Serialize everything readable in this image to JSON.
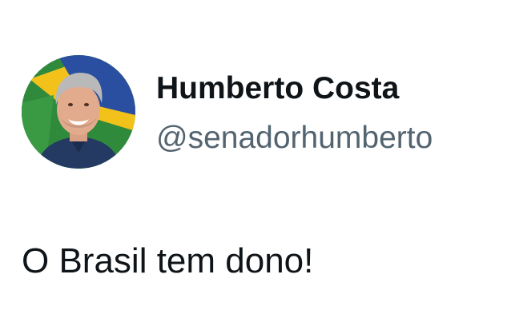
{
  "author": {
    "display_name": "Humberto Costa",
    "handle": "@senadorhumberto",
    "avatar_icon": "profile-photo-avatar"
  },
  "tweet": {
    "text": "O Brasil tem dono!"
  },
  "colors": {
    "text_primary": "#0f1419",
    "text_secondary": "#536471",
    "background": "#ffffff",
    "avatar_green": "#2f8a3c",
    "avatar_yellow": "#f2c21b",
    "avatar_blue": "#2a4fa0"
  }
}
